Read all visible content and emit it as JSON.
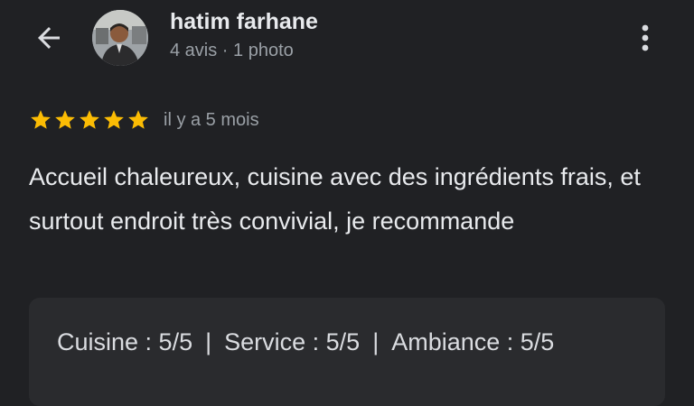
{
  "user": {
    "name": "hatim farhane",
    "meta": "4 avis · 1 photo"
  },
  "review": {
    "rating": 5,
    "rating_max": 5,
    "time": "il y a 5 mois",
    "text": "Accueil chaleureux, cuisine avec des ingrédients frais, et surtout endroit très convivial, je recommande",
    "details": {
      "cuisine": "Cuisine : 5/5",
      "service": "Service : 5/5",
      "ambiance": "Ambiance : 5/5",
      "separator": "|"
    }
  },
  "icons": {
    "back": "arrow-back-icon",
    "more": "more-vert-icon",
    "star": "star-icon"
  },
  "colors": {
    "background": "#202124",
    "card": "#2a2b2e",
    "star": "#fbbc04",
    "text_primary": "#e8eaed",
    "text_secondary": "#9aa0a6"
  }
}
